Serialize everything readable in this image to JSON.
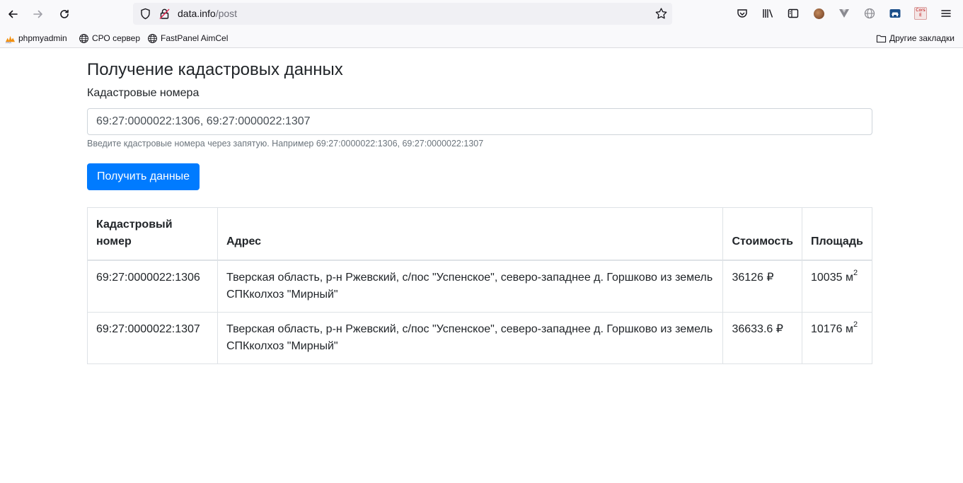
{
  "browser": {
    "url_host": "data.info",
    "url_path": "/post",
    "bookmarks": [
      {
        "label": "phpmyadmin",
        "icon": "phpmyadmin-icon"
      },
      {
        "label": "СРО сервер",
        "icon": "globe-icon"
      },
      {
        "label": "FastPanel AimCel",
        "icon": "globe-icon"
      }
    ],
    "other_bookmarks": "Другие закладки",
    "cors_badge": "Cors\nE"
  },
  "page": {
    "title": "Получение кадастровых данных",
    "input_label": "Кадастровые номера",
    "input_value": "69:27:0000022:1306, 69:27:0000022:1307",
    "help_text": "Введите кдастровые номера через запятую. Например 69:27:0000022:1306, 69:27:0000022:1307",
    "submit_label": "Получить данные"
  },
  "table": {
    "headers": [
      "Кадастровый номер",
      "Адрес",
      "Стоимость",
      "Площадь"
    ],
    "rows": [
      {
        "number": "69:27:0000022:1306",
        "address": "Тверская область, р-н Ржевский, с/пос \"Успенское\", северо-западнее д. Горшково из земель СПКколхоз \"Мирный\"",
        "cost": "36126 ₽",
        "area": "10035 м",
        "area_unit_sup": "2"
      },
      {
        "number": "69:27:0000022:1307",
        "address": "Тверская область, р-н Ржевский, с/пос \"Успенское\", северо-западнее д. Горшково из земель СПКколхоз \"Мирный\"",
        "cost": "36633.6 ₽",
        "area": "10176 м",
        "area_unit_sup": "2"
      }
    ]
  },
  "colors": {
    "primary": "#007bff",
    "border": "#dee2e6",
    "muted": "#6c757d"
  }
}
